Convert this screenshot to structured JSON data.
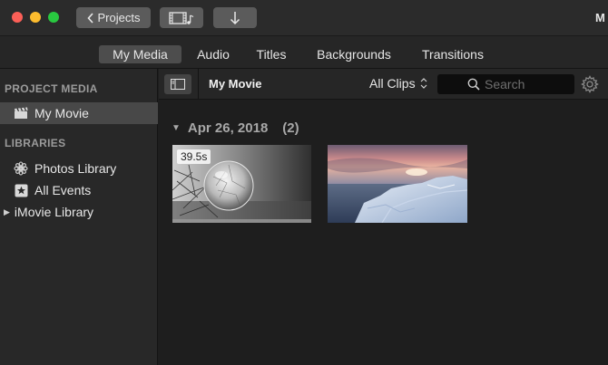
{
  "toolbar": {
    "projects_label": "Projects",
    "right_edge_text": "M"
  },
  "tabs": [
    {
      "label": "My Media",
      "active": true
    },
    {
      "label": "Audio",
      "active": false
    },
    {
      "label": "Titles",
      "active": false
    },
    {
      "label": "Backgrounds",
      "active": false
    },
    {
      "label": "Transitions",
      "active": false
    }
  ],
  "sidebar": {
    "project_media_header": "PROJECT MEDIA",
    "project_item": "My Movie",
    "libraries_header": "LIBRARIES",
    "libraries": [
      {
        "label": "Photos Library",
        "icon": "photos-icon"
      },
      {
        "label": "All Events",
        "icon": "star-icon"
      },
      {
        "label": "iMovie Library",
        "icon": "disclosure-triangle-icon"
      }
    ]
  },
  "browser": {
    "title": "My Movie",
    "filter": "All Clips",
    "search_placeholder": "Search"
  },
  "content": {
    "date": "Apr 26, 2018",
    "count": "(2)",
    "clips": [
      {
        "duration": "39.5s",
        "description": "frozen bubble on pine branch"
      },
      {
        "duration": "",
        "description": "icy shoreline at sunset"
      }
    ]
  },
  "colors": {
    "window_bg": "#1e1e1e",
    "toolbar_bg": "#2b2b2b",
    "sidebar_bg": "#282828",
    "selection": "#484848",
    "close": "#fc5f57",
    "minimize": "#fdbc2e",
    "zoom": "#29c840"
  }
}
